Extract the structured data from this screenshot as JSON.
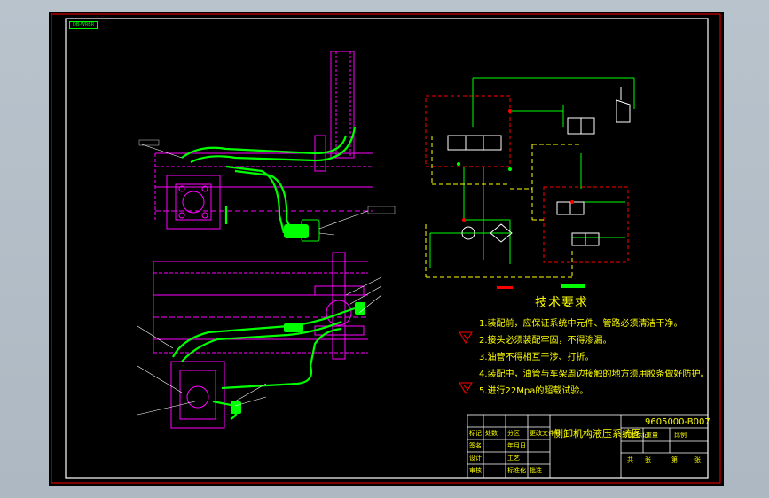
{
  "drawing_tag": "DB-WRBR",
  "tech_requirements": {
    "title": "技术要求",
    "items": [
      "1.装配前，应保证系统中元件、管路必须清洁干净。",
      "2.接头必须装配牢固，不得渗漏。",
      "3.油管不得相互干涉、打折。",
      "4.装配中，油管与车架周边接触的地方须用胶条做好防护。",
      "5.进行22Mpa的超载试验。"
    ]
  },
  "title_block": {
    "drawing_title": "侧卸机构液压系统图",
    "drawing_number": "9605000-B007",
    "left_labels": [
      "标记",
      "处数",
      "分区",
      "更改文件号",
      "签名",
      "年月日"
    ],
    "rows": [
      "设计",
      "审核",
      "工艺",
      "标准化",
      "批准"
    ],
    "right_labels": [
      "阶段标记",
      "重量",
      "比例"
    ],
    "sheet_labels": [
      "共",
      "张",
      "第",
      "张"
    ]
  },
  "colors": {
    "background": "#000000",
    "border": "#ff0000",
    "frame": "#ffffff",
    "hydraulic_lines": "#00ff00",
    "dashed_boundary": "#ff0000",
    "frame_parts": "#ff00ff",
    "text": "#ffff00"
  }
}
